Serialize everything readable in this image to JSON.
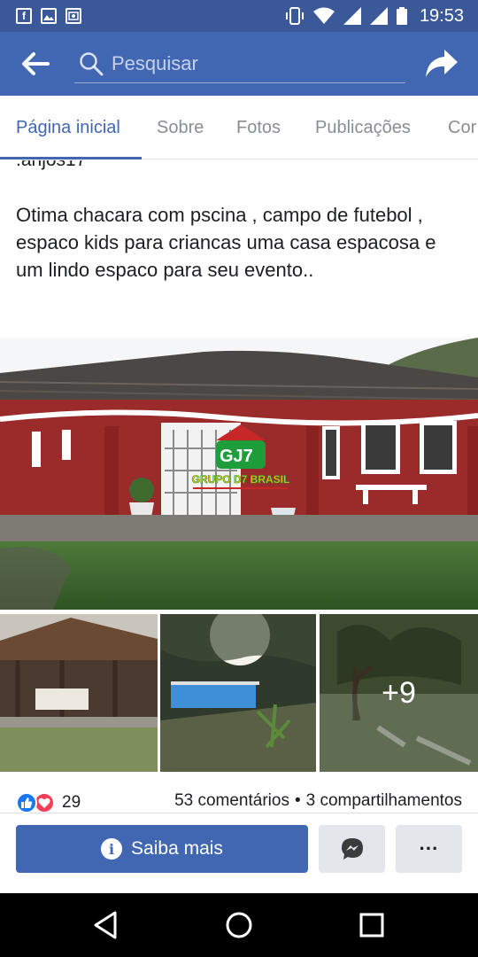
{
  "status_bar": {
    "time": "19:53",
    "left_icons": [
      "facebook-notification-icon",
      "image-notification-icon",
      "photo-notification-icon"
    ],
    "right_icons": [
      "vibrate-icon",
      "wifi-icon",
      "signal-icon",
      "signal-icon",
      "battery-icon"
    ]
  },
  "app_bar": {
    "search_placeholder": "Pesquisar"
  },
  "tabs": [
    {
      "label": "Página inicial",
      "active": true
    },
    {
      "label": "Sobre",
      "active": false
    },
    {
      "label": "Fotos",
      "active": false
    },
    {
      "label": "Publicações",
      "active": false
    },
    {
      "label": "Cor",
      "active": false
    }
  ],
  "post": {
    "cut_text": ".anjos17",
    "text": "Otima chacara com pscina , campo de futebol , espaco kids para criancas uma casa espacosa e um lindo espaco para seu evento..",
    "watermark": "GRUPO D7 BRASIL",
    "more_photos": "+9"
  },
  "engagement": {
    "reaction_count": "29",
    "comments": "53 comentários",
    "separator": "•",
    "shares": "3 compartilhamentos"
  },
  "actions": {
    "cta_label": "Saiba mais",
    "more_label": "···"
  },
  "colors": {
    "brand": "#4267b2",
    "status_bar": "#3b5998",
    "like_blue": "#1877f2",
    "love_red": "#f33e58"
  }
}
